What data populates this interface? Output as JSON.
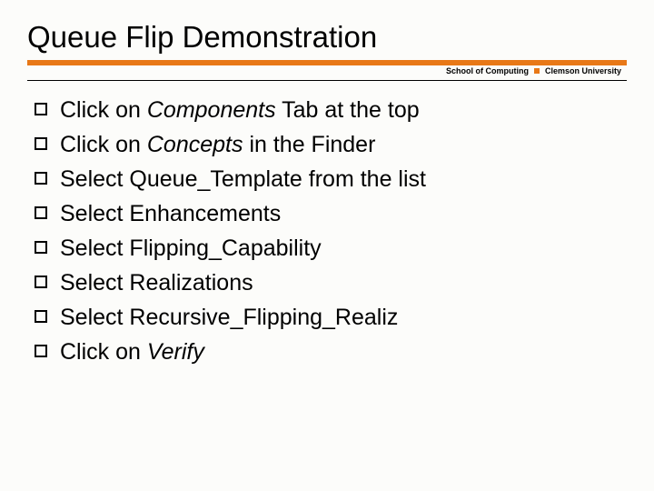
{
  "title": "Queue Flip Demonstration",
  "subheader": {
    "left": "School of Computing",
    "right": "Clemson University"
  },
  "items": [
    {
      "prefix": "Click on ",
      "em": "Components",
      "suffix": " Tab at the top"
    },
    {
      "prefix": "Click on ",
      "em": "Concepts",
      "suffix": " in the Finder"
    },
    {
      "prefix": "Select Queue_Template from the list",
      "em": "",
      "suffix": ""
    },
    {
      "prefix": "Select Enhancements",
      "em": "",
      "suffix": ""
    },
    {
      "prefix": "Select Flipping_Capability",
      "em": "",
      "suffix": ""
    },
    {
      "prefix": "Select Realizations",
      "em": "",
      "suffix": ""
    },
    {
      "prefix": "Select Recursive_Flipping_Realiz",
      "em": "",
      "suffix": ""
    },
    {
      "prefix": "Click on ",
      "em": "Verify",
      "suffix": ""
    }
  ]
}
